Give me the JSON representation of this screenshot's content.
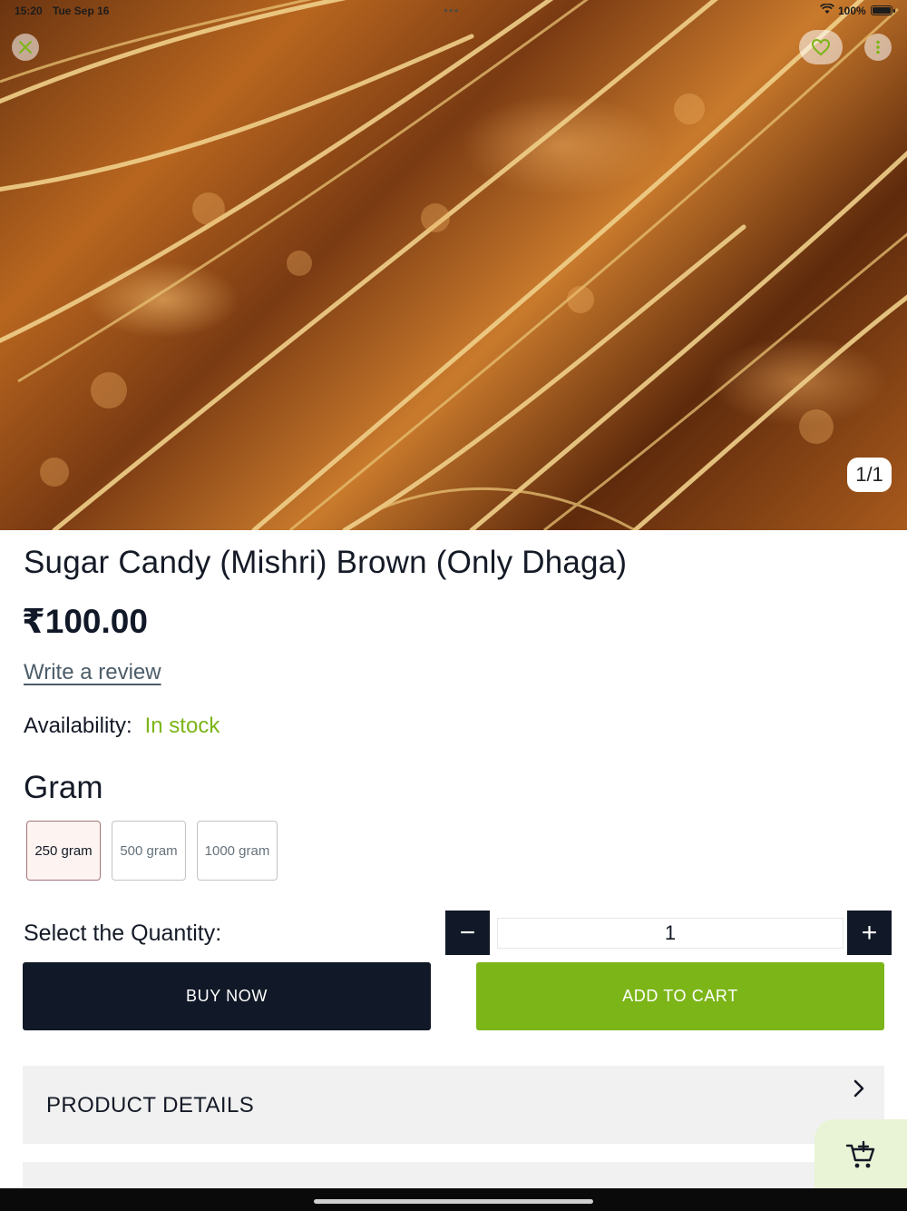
{
  "status_bar": {
    "time": "15:20",
    "date": "Tue Sep 16",
    "dots": "•••",
    "battery": "100%"
  },
  "product": {
    "image_alt": "Sugar candy crystals on strings",
    "page_indicator": "1/1",
    "title": "Sugar Candy (Mishri) Brown (Only Dhaga)",
    "price": "₹100.00",
    "review_link": "Write a review",
    "availability_label": "Availability:",
    "availability_value": "In stock"
  },
  "variants": {
    "heading": "Gram",
    "options": [
      {
        "label": "250 gram",
        "selected": true
      },
      {
        "label": "500 gram",
        "selected": false
      },
      {
        "label": "1000 gram",
        "selected": false
      }
    ]
  },
  "quantity": {
    "label": "Select the Quantity:",
    "minus": "−",
    "value": "1",
    "plus": "+"
  },
  "actions": {
    "buy_now": "BUY NOW",
    "add_to_cart": "ADD TO CART"
  },
  "sections": {
    "product_details": "PRODUCT DETAILS"
  },
  "colors": {
    "accent_green": "#7cb518",
    "dark_navy": "#111827",
    "section_gray": "#f1f1f1",
    "fab_bg": "#e9f3d6"
  },
  "icons": {
    "close": "close-icon",
    "wishlist": "heart-icon",
    "more": "more-vertical-icon",
    "chevron": "chevron-right-icon",
    "cart": "add-to-cart-icon"
  }
}
